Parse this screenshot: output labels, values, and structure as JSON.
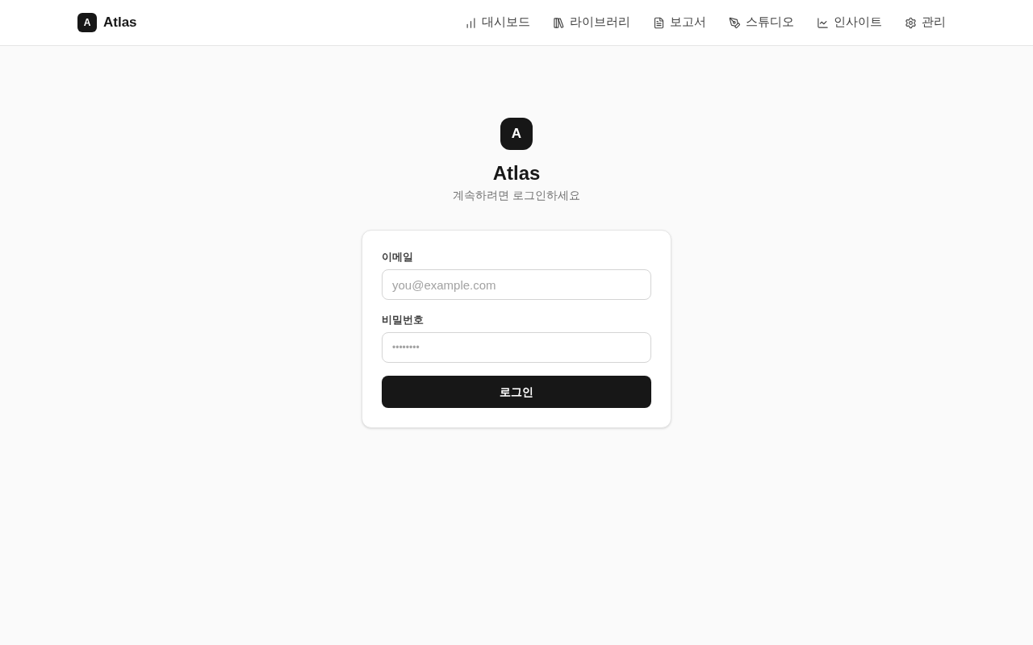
{
  "header": {
    "brand": {
      "logo_letter": "A",
      "name": "Atlas"
    },
    "nav": [
      {
        "kind": "dashboard",
        "label": "대시보드"
      },
      {
        "kind": "library",
        "label": "라이브러리"
      },
      {
        "kind": "report",
        "label": "보고서"
      },
      {
        "kind": "studio",
        "label": "스튜디오"
      },
      {
        "kind": "insight",
        "label": "인사이트"
      },
      {
        "kind": "admin",
        "label": "관리"
      }
    ]
  },
  "login": {
    "logo_letter": "A",
    "title": "Atlas",
    "subtitle": "계속하려면 로그인하세요",
    "fields": [
      {
        "kind": "email",
        "label": "이메일",
        "placeholder": "you@example.com"
      },
      {
        "kind": "password",
        "label": "비밀번호",
        "placeholder": "••••••••"
      }
    ],
    "submit": "로그인"
  }
}
